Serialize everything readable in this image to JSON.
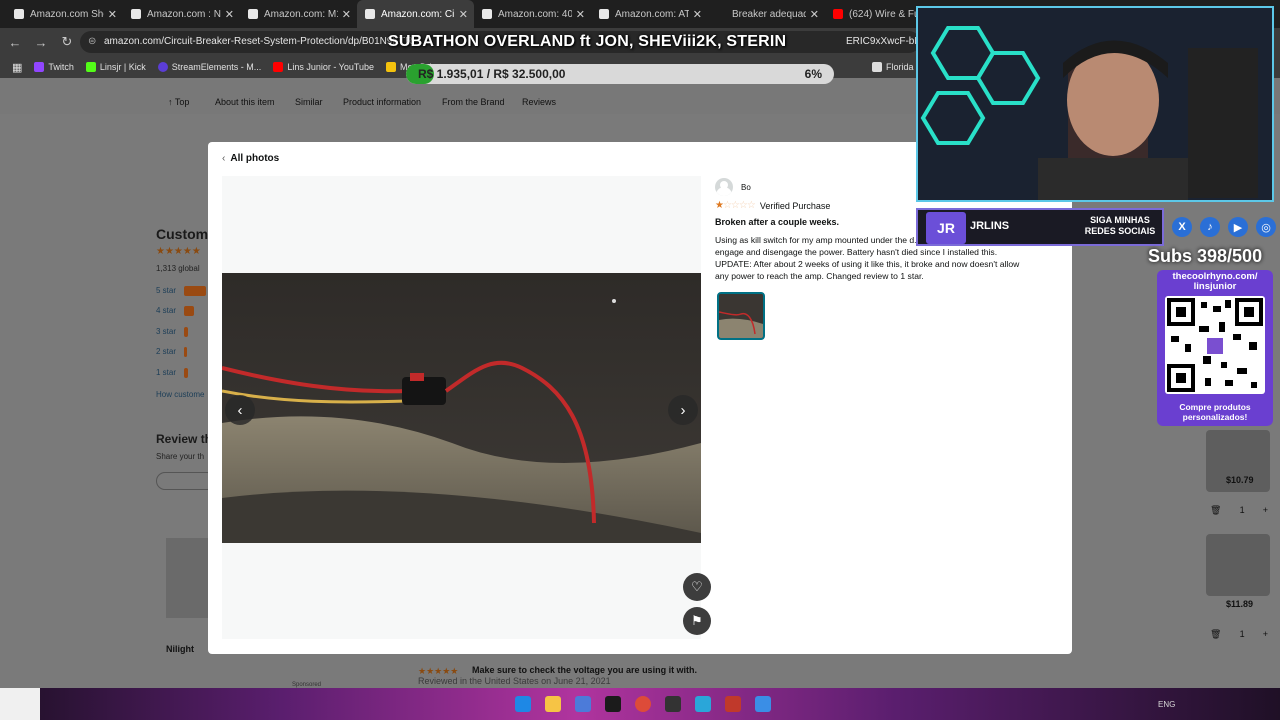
{
  "browser": {
    "tabs": [
      {
        "title": "Amazon.com Shop",
        "active": false
      },
      {
        "title": "Amazon.com : Nilig",
        "active": false
      },
      {
        "title": "Amazon.com: M1A",
        "active": false
      },
      {
        "title": "Amazon.com: Circu",
        "active": true
      },
      {
        "title": "Amazon.com: 400W",
        "active": false
      },
      {
        "title": "Amazon.com: ATEM",
        "active": false
      },
      {
        "title": "Breaker adequado",
        "active": false
      },
      {
        "title": "(624) Wire & Fuse",
        "active": false
      }
    ],
    "url": "amazon.com/Circuit-Breaker-Reset-System-Protection/dp/B01N9KTR",
    "url_tail": "ERIC9xXwcF-bN",
    "bookmarks": [
      "Twitch",
      "Linsjr | Kick",
      "StreamElements - M...",
      "Lins Junior - YouTube",
      "Meu Drive",
      "Florida FWC"
    ]
  },
  "amazon_page": {
    "subnav": [
      "Top",
      "About this item",
      "Similar",
      "Product information",
      "From the Brand",
      "Reviews"
    ],
    "customer_reviews_heading": "Custom",
    "global_ratings": "1,313 global",
    "star_rows": [
      "5 star",
      "4 star",
      "3 star",
      "2 star",
      "1 star"
    ],
    "how_customers": "How custome",
    "review_this": "Review th",
    "share_your": "Share your th",
    "nilight": "Nilight",
    "sponsored": "Sponsored",
    "review_headline": "Make sure to check the voltage you are using it with.",
    "reviewed_in": "Reviewed in the United States on June 21, 2021",
    "side_prices": [
      "$10.79",
      "$11.89"
    ],
    "side_qty": "1"
  },
  "modal": {
    "all_photos": "All photos",
    "reviewer_name": "Bo",
    "rating": 1,
    "verified": "Verified Purchase",
    "review_title": "Broken after a couple weeks.",
    "review_body": "Using as kill switch for my amp mounted under the d... small and quick to engage and disengage the power. Battery hasn't died since I installed this. UPDATE: After about 2 weeks of using it like this, it broke and now doesn't allow any power to reach the amp. Changed review to 1 star.",
    "prev_icon": "chevron-left-icon",
    "next_icon": "chevron-right-icon",
    "heart_icon": "heart-icon",
    "flag_icon": "flag-icon"
  },
  "overlay": {
    "title": "SUBATHON OVERLAND ft JON, SHEViii2K, STERIN",
    "goal_text": "R$ 1.935,01 / R$ 32.500,00",
    "goal_percent": "6%",
    "goal_fraction": 0.06,
    "social_name": "JRLINS",
    "social_cta": "SIGA MINHAS REDES SOCIAIS",
    "subs": "Subs 398/500",
    "qr_handle": "thecoolrhyno.com/ linsjunior",
    "qr_cta": "Compre produtos personalizados!"
  },
  "taskbar": {
    "tray_lang": "ENG"
  },
  "colors": {
    "accent_star": "#de7921",
    "link_teal": "#007185",
    "goal_green": "#2aa12f",
    "overlay_purple": "#6a3fd0"
  }
}
